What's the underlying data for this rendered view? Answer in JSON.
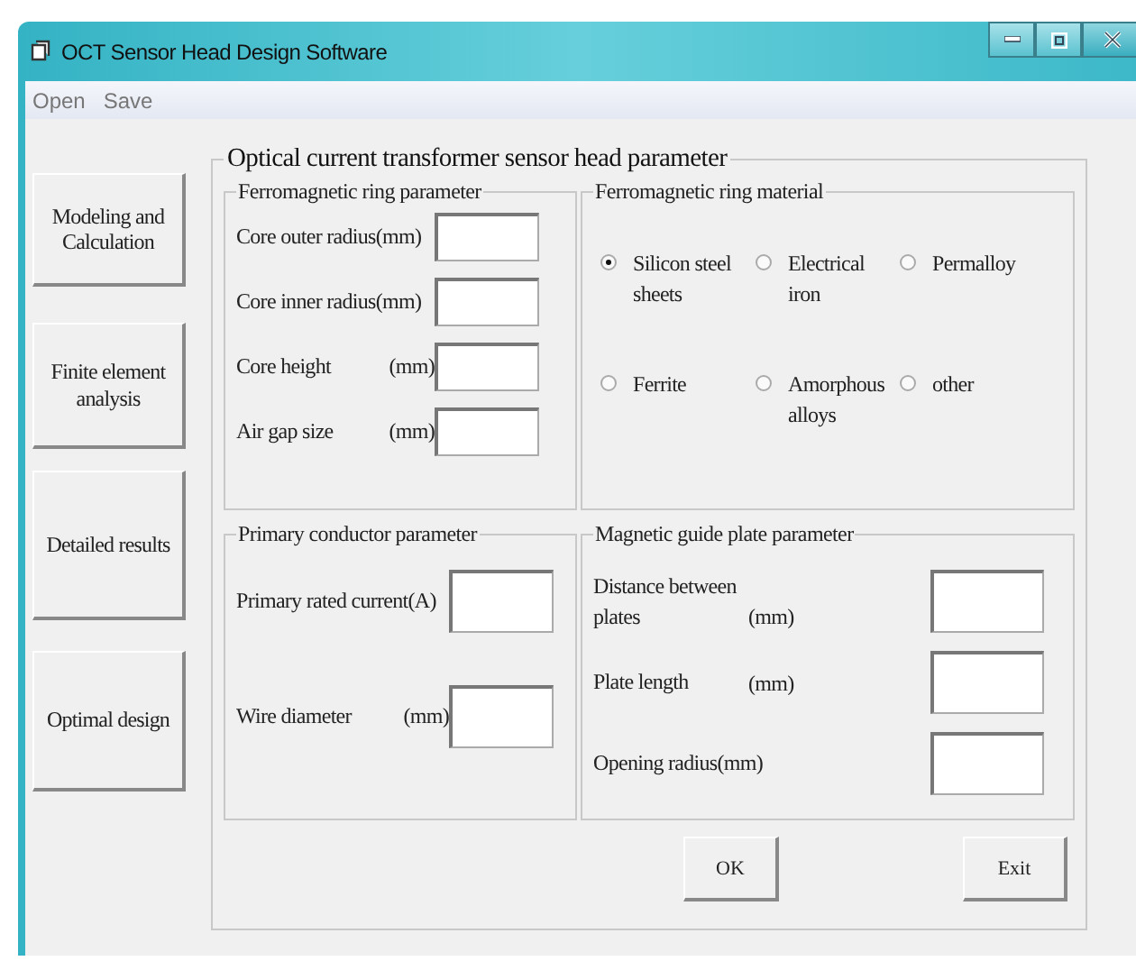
{
  "window": {
    "title": "OCT Sensor Head Design Software"
  },
  "menu": [
    "Open",
    "Save"
  ],
  "nav_buttons": [
    "Modeling and Calculation",
    "Finite element analysis",
    "Detailed results",
    "Optimal design"
  ],
  "main_group": {
    "title": "Optical current transformer sensor head parameter"
  },
  "ring_parameters": {
    "title": "Ferromagnetic ring parameter",
    "fields": [
      {
        "label": "Core outer radius(mm)"
      },
      {
        "label": "Core inner radius(mm)"
      },
      {
        "label": "Core height",
        "unit": "(mm)"
      },
      {
        "label": "Air gap size",
        "unit": "(mm)"
      }
    ]
  },
  "ring_material": {
    "title": "Ferromagnetic ring material",
    "options": [
      {
        "label": "Silicon steel sheets",
        "selected": true
      },
      {
        "label": "Electrical iron",
        "selected": false
      },
      {
        "label": "Permalloy",
        "selected": false
      },
      {
        "label": "Ferrite",
        "selected": false
      },
      {
        "label": "Amorphous alloys",
        "selected": false
      },
      {
        "label": "other",
        "selected": false
      }
    ]
  },
  "primary_conductor": {
    "title": "Primary conductor parameter",
    "fields": [
      {
        "label": "Primary rated current(A)"
      },
      {
        "label": "Wire diameter",
        "unit": "(mm)"
      }
    ]
  },
  "guide_plate": {
    "title": "Magnetic guide plate parameter",
    "fields": [
      {
        "label": "Distance between plates",
        "unit": "(mm)"
      },
      {
        "label": "Plate length",
        "unit": "(mm)"
      },
      {
        "label": "Opening radius(mm)"
      }
    ]
  },
  "buttons": [
    "OK",
    "Exit"
  ]
}
